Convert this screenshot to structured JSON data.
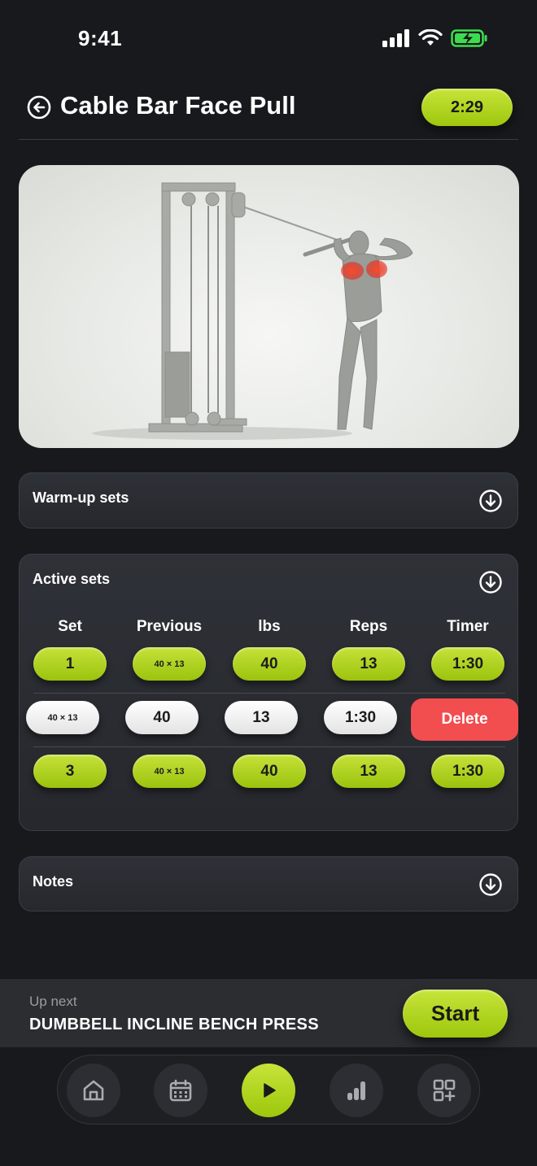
{
  "status": {
    "time": "9:41"
  },
  "header": {
    "title": "Cable Bar Face Pull",
    "timer": "2:29"
  },
  "warmup": {
    "title": "Warm-up sets"
  },
  "active": {
    "title": "Active sets",
    "columns": [
      "Set",
      "Previous",
      "lbs",
      "Reps",
      "Timer"
    ],
    "rows": [
      {
        "set": "1",
        "previous": "40 × 13",
        "lbs": "40",
        "reps": "13",
        "timer": "1:30"
      },
      {
        "previous": "40 × 13",
        "lbs": "40",
        "reps": "13",
        "timer": "1:30",
        "delete_label": "Delete"
      },
      {
        "set": "3",
        "previous": "40 × 13",
        "lbs": "40",
        "reps": "13",
        "timer": "1:30"
      }
    ]
  },
  "notes": {
    "title": "Notes"
  },
  "up_next": {
    "label": "Up next",
    "name": "DUMBBELL INCLINE BENCH PRESS",
    "start_label": "Start"
  },
  "tabbar": {
    "items": [
      "home-icon",
      "calendar-icon",
      "play-icon",
      "stats-icon",
      "add-widget-icon"
    ],
    "active": "play-icon"
  },
  "colors": {
    "accent": "#b4d625",
    "danger": "#f24d4f",
    "background": "#18191c",
    "panel": "#2a2c31"
  }
}
